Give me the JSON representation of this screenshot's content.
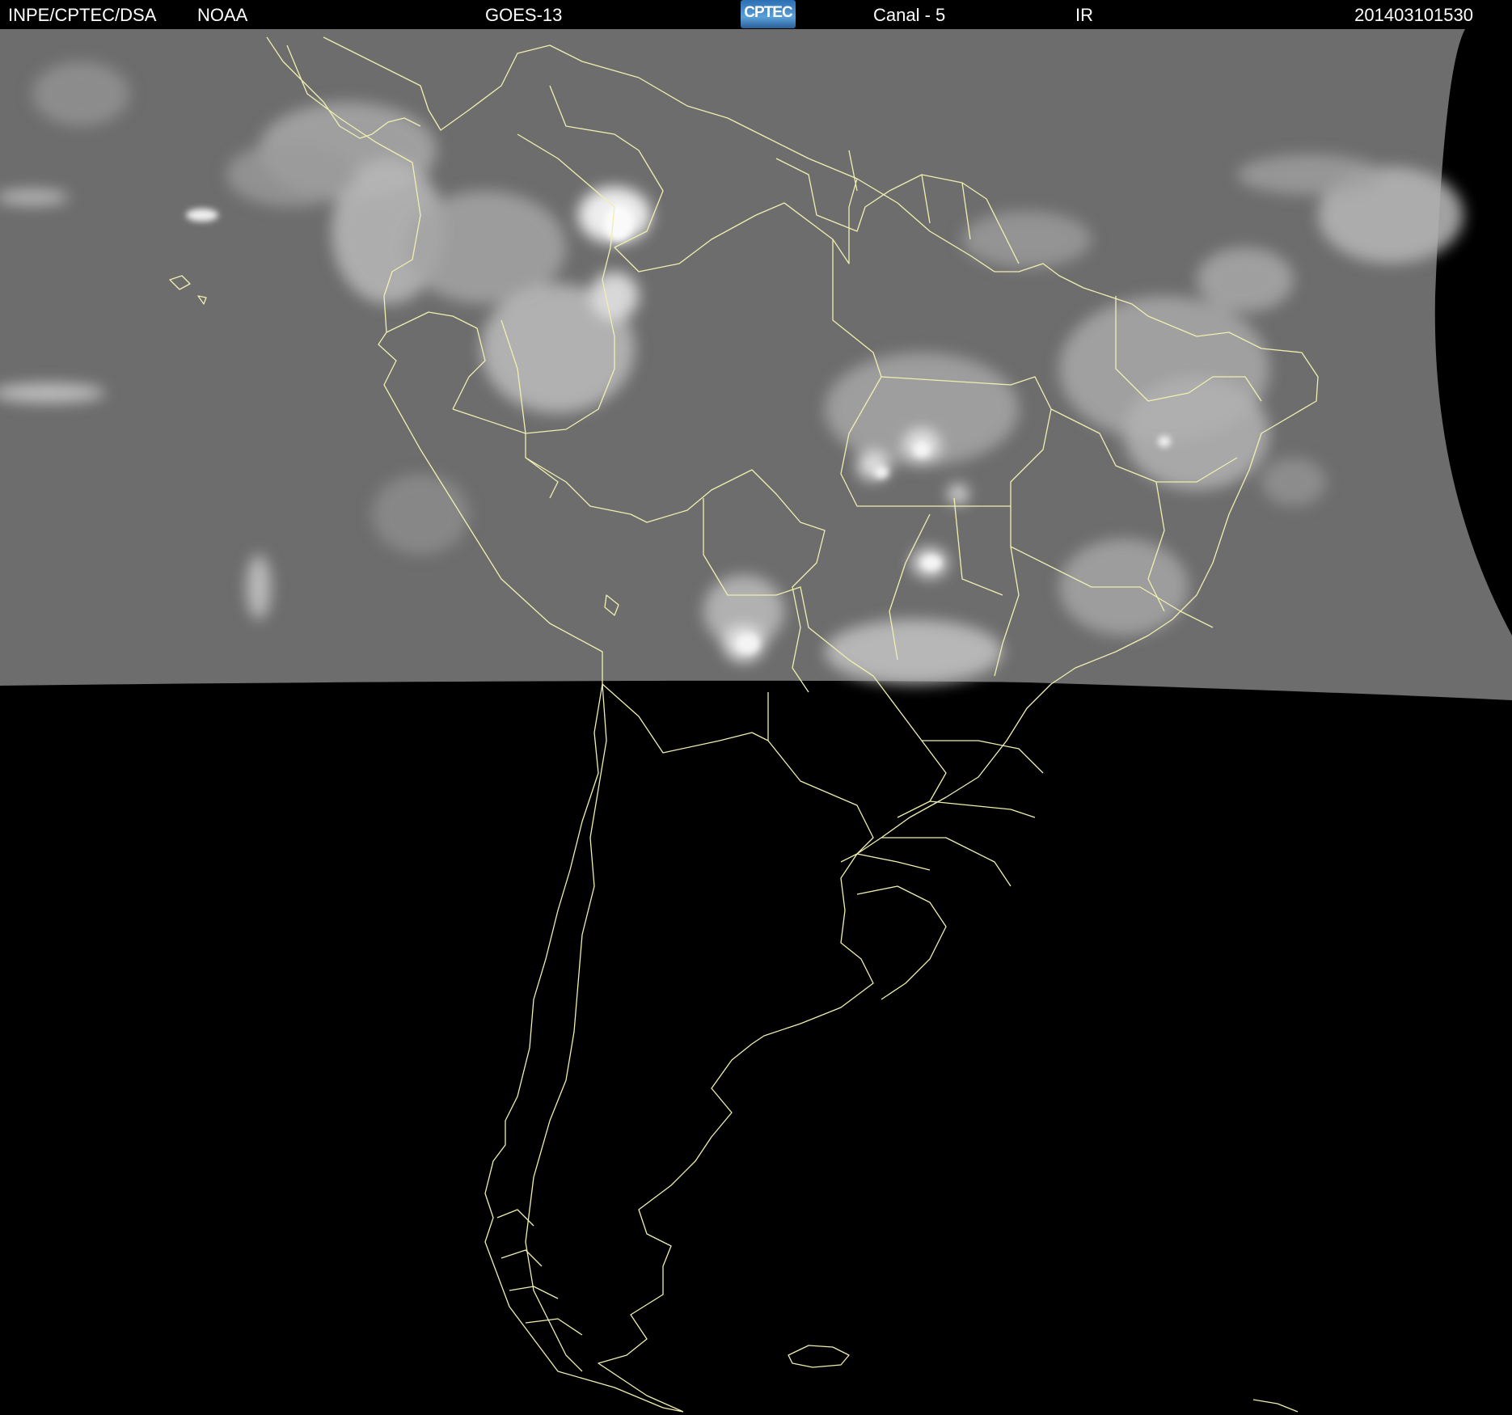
{
  "header": {
    "agency": "INPE/CPTEC/DSA",
    "source": "NOAA",
    "satellite": "GOES-13",
    "logo_text": "CPTEC",
    "channel": "Canal - 5",
    "band": "IR",
    "timestamp": "201403101530"
  },
  "map": {
    "coverage_fill": "#6d6d6d",
    "no_data_fill": "#000000",
    "border_color": "#f0efb0",
    "cloud_color": "#ffffff"
  }
}
